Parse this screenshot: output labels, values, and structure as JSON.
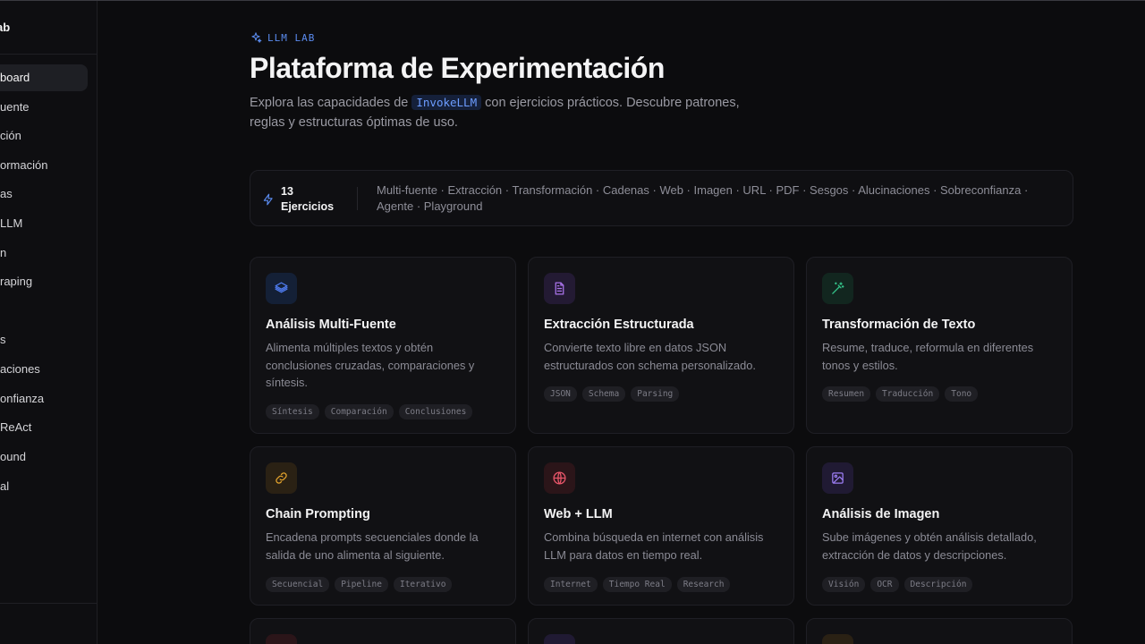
{
  "sidebar": {
    "title": "ab",
    "items": [
      {
        "label": "board",
        "active": true
      },
      {
        "label": "uente"
      },
      {
        "label": "ción"
      },
      {
        "label": "ormación"
      },
      {
        "label": "as"
      },
      {
        "label": "LLM"
      },
      {
        "label": "n"
      },
      {
        "label": "raping"
      },
      {
        "label": ""
      },
      {
        "label": "s"
      },
      {
        "label": "aciones"
      },
      {
        "label": "onfianza"
      },
      {
        "label": "ReAct"
      },
      {
        "label": "ound"
      },
      {
        "label": "al"
      }
    ]
  },
  "header": {
    "eyebrow": "LLM LAB",
    "title": "Plataforma de Experimentación",
    "subtitle_pre": "Explora las capacidades de ",
    "subtitle_code": "InvokeLLM",
    "subtitle_post": " con ejercicios prácticos. Descubre patrones, reglas y estructuras óptimas de uso."
  },
  "info": {
    "count": "13 Ejercicios",
    "topics": "Multi-fuente · Extracción · Transformación · Cadenas · Web · Imagen · URL · PDF · Sesgos · Alucinaciones · Sobreconfianza · Agente · Playground"
  },
  "cards": [
    {
      "title": "Análisis Multi-Fuente",
      "desc": "Alimenta múltiples textos y obtén conclusiones cruzadas, comparaciones y síntesis.",
      "tags": [
        "Síntesis",
        "Comparación",
        "Conclusiones"
      ],
      "icon": "layers-icon",
      "color": "#4f7cf0",
      "bg": "#142036"
    },
    {
      "title": "Extracción Estructurada",
      "desc": "Convierte texto libre en datos JSON estructurados con schema personalizado.",
      "tags": [
        "JSON",
        "Schema",
        "Parsing"
      ],
      "icon": "document-icon",
      "color": "#a872e8",
      "bg": "#231a33"
    },
    {
      "title": "Transformación de Texto",
      "desc": "Resume, traduce, reformula en diferentes tonos y estilos.",
      "tags": [
        "Resumen",
        "Traducción",
        "Tono"
      ],
      "icon": "magic-wand-icon",
      "color": "#34c48a",
      "bg": "#12261f"
    },
    {
      "title": "Chain Prompting",
      "desc": "Encadena prompts secuenciales donde la salida de uno alimenta al siguiente.",
      "tags": [
        "Secuencial",
        "Pipeline",
        "Iterativo"
      ],
      "icon": "link-icon",
      "color": "#e2a22c",
      "bg": "#2a2114"
    },
    {
      "title": "Web + LLM",
      "desc": "Combina búsqueda en internet con análisis LLM para datos en tiempo real.",
      "tags": [
        "Internet",
        "Tiempo Real",
        "Research"
      ],
      "icon": "globe-icon",
      "color": "#e9566a",
      "bg": "#2b1519"
    },
    {
      "title": "Análisis de Imagen",
      "desc": "Sube imágenes y obtén análisis detallado, extracción de datos y descripciones.",
      "tags": [
        "Visión",
        "OCR",
        "Descripción"
      ],
      "icon": "image-icon",
      "color": "#9b7cf2",
      "bg": "#201a33"
    },
    {
      "title": "",
      "desc": "",
      "tags": [],
      "icon": "partial-icon",
      "color": "#e9566a",
      "bg": "#2b1519"
    },
    {
      "title": "",
      "desc": "",
      "tags": [],
      "icon": "partial-icon",
      "color": "#9b7cf2",
      "bg": "#201a33"
    },
    {
      "title": "",
      "desc": "",
      "tags": [],
      "icon": "partial-icon",
      "color": "#e2a22c",
      "bg": "#2a2114"
    }
  ]
}
